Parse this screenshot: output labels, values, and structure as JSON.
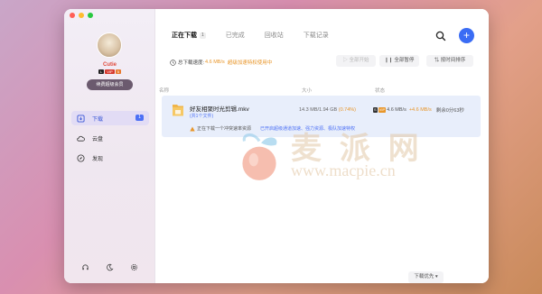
{
  "sidebar": {
    "username": "Cutie",
    "badges": [
      "L",
      "VIP",
      "5"
    ],
    "vip_button": "续费超级会员",
    "items": [
      {
        "label": "下载",
        "count": "1"
      },
      {
        "label": "云盘"
      },
      {
        "label": "发现"
      }
    ]
  },
  "main": {
    "tabs": [
      {
        "label": "正在下载",
        "badge": "1"
      },
      {
        "label": "已完成"
      },
      {
        "label": "回收站"
      },
      {
        "label": "下载记录"
      }
    ],
    "speed": {
      "label": "总下载速度:",
      "value": "4.6 MB/s",
      "link": "超级加速特权使用中"
    },
    "actions": {
      "start_all": "全部开始",
      "pause_all": "全部暂停",
      "sort_time": "按时间排序"
    },
    "columns": {
      "name": "名称",
      "size": "大小",
      "status": "状态"
    },
    "row": {
      "name": "好友相聚时光剪辑.mkv",
      "sub": "(共1个文件)",
      "size": "14.3 MB/1.94 GB",
      "percent": "(0.74%)",
      "status_badges": [
        "S",
        "VIP"
      ],
      "speed": "4.6 MB/s",
      "boost": "+4.6 MB/s",
      "remaining": "剩余0分63秒",
      "notice": "正在下载一个冲突速率资源",
      "notice_link": "已开启超级通道加速、强力资源、极队加速特权"
    },
    "sort_button": "下载优先 ▾",
    "watermark": {
      "cn": "麦 派 网",
      "en": "www.macpie.cn"
    }
  },
  "colors": {
    "accent": "#3a6cf4",
    "orange": "#e8962a",
    "active_nav": "#e2dcf5"
  }
}
